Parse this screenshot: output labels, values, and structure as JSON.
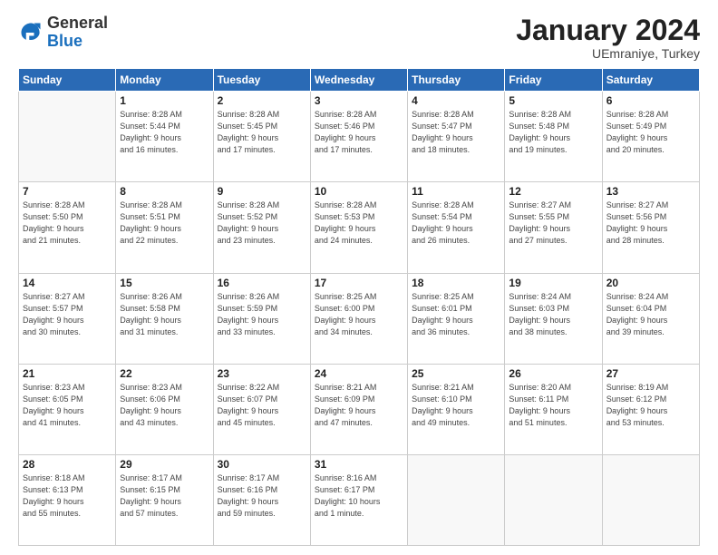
{
  "header": {
    "logo_general": "General",
    "logo_blue": "Blue",
    "title": "January 2024",
    "subtitle": "UEmraniye, Turkey"
  },
  "days_of_week": [
    "Sunday",
    "Monday",
    "Tuesday",
    "Wednesday",
    "Thursday",
    "Friday",
    "Saturday"
  ],
  "weeks": [
    [
      {
        "day": "",
        "info": ""
      },
      {
        "day": "1",
        "info": "Sunrise: 8:28 AM\nSunset: 5:44 PM\nDaylight: 9 hours\nand 16 minutes."
      },
      {
        "day": "2",
        "info": "Sunrise: 8:28 AM\nSunset: 5:45 PM\nDaylight: 9 hours\nand 17 minutes."
      },
      {
        "day": "3",
        "info": "Sunrise: 8:28 AM\nSunset: 5:46 PM\nDaylight: 9 hours\nand 17 minutes."
      },
      {
        "day": "4",
        "info": "Sunrise: 8:28 AM\nSunset: 5:47 PM\nDaylight: 9 hours\nand 18 minutes."
      },
      {
        "day": "5",
        "info": "Sunrise: 8:28 AM\nSunset: 5:48 PM\nDaylight: 9 hours\nand 19 minutes."
      },
      {
        "day": "6",
        "info": "Sunrise: 8:28 AM\nSunset: 5:49 PM\nDaylight: 9 hours\nand 20 minutes."
      }
    ],
    [
      {
        "day": "7",
        "info": "Sunrise: 8:28 AM\nSunset: 5:50 PM\nDaylight: 9 hours\nand 21 minutes."
      },
      {
        "day": "8",
        "info": "Sunrise: 8:28 AM\nSunset: 5:51 PM\nDaylight: 9 hours\nand 22 minutes."
      },
      {
        "day": "9",
        "info": "Sunrise: 8:28 AM\nSunset: 5:52 PM\nDaylight: 9 hours\nand 23 minutes."
      },
      {
        "day": "10",
        "info": "Sunrise: 8:28 AM\nSunset: 5:53 PM\nDaylight: 9 hours\nand 24 minutes."
      },
      {
        "day": "11",
        "info": "Sunrise: 8:28 AM\nSunset: 5:54 PM\nDaylight: 9 hours\nand 26 minutes."
      },
      {
        "day": "12",
        "info": "Sunrise: 8:27 AM\nSunset: 5:55 PM\nDaylight: 9 hours\nand 27 minutes."
      },
      {
        "day": "13",
        "info": "Sunrise: 8:27 AM\nSunset: 5:56 PM\nDaylight: 9 hours\nand 28 minutes."
      }
    ],
    [
      {
        "day": "14",
        "info": "Sunrise: 8:27 AM\nSunset: 5:57 PM\nDaylight: 9 hours\nand 30 minutes."
      },
      {
        "day": "15",
        "info": "Sunrise: 8:26 AM\nSunset: 5:58 PM\nDaylight: 9 hours\nand 31 minutes."
      },
      {
        "day": "16",
        "info": "Sunrise: 8:26 AM\nSunset: 5:59 PM\nDaylight: 9 hours\nand 33 minutes."
      },
      {
        "day": "17",
        "info": "Sunrise: 8:25 AM\nSunset: 6:00 PM\nDaylight: 9 hours\nand 34 minutes."
      },
      {
        "day": "18",
        "info": "Sunrise: 8:25 AM\nSunset: 6:01 PM\nDaylight: 9 hours\nand 36 minutes."
      },
      {
        "day": "19",
        "info": "Sunrise: 8:24 AM\nSunset: 6:03 PM\nDaylight: 9 hours\nand 38 minutes."
      },
      {
        "day": "20",
        "info": "Sunrise: 8:24 AM\nSunset: 6:04 PM\nDaylight: 9 hours\nand 39 minutes."
      }
    ],
    [
      {
        "day": "21",
        "info": "Sunrise: 8:23 AM\nSunset: 6:05 PM\nDaylight: 9 hours\nand 41 minutes."
      },
      {
        "day": "22",
        "info": "Sunrise: 8:23 AM\nSunset: 6:06 PM\nDaylight: 9 hours\nand 43 minutes."
      },
      {
        "day": "23",
        "info": "Sunrise: 8:22 AM\nSunset: 6:07 PM\nDaylight: 9 hours\nand 45 minutes."
      },
      {
        "day": "24",
        "info": "Sunrise: 8:21 AM\nSunset: 6:09 PM\nDaylight: 9 hours\nand 47 minutes."
      },
      {
        "day": "25",
        "info": "Sunrise: 8:21 AM\nSunset: 6:10 PM\nDaylight: 9 hours\nand 49 minutes."
      },
      {
        "day": "26",
        "info": "Sunrise: 8:20 AM\nSunset: 6:11 PM\nDaylight: 9 hours\nand 51 minutes."
      },
      {
        "day": "27",
        "info": "Sunrise: 8:19 AM\nSunset: 6:12 PM\nDaylight: 9 hours\nand 53 minutes."
      }
    ],
    [
      {
        "day": "28",
        "info": "Sunrise: 8:18 AM\nSunset: 6:13 PM\nDaylight: 9 hours\nand 55 minutes."
      },
      {
        "day": "29",
        "info": "Sunrise: 8:17 AM\nSunset: 6:15 PM\nDaylight: 9 hours\nand 57 minutes."
      },
      {
        "day": "30",
        "info": "Sunrise: 8:17 AM\nSunset: 6:16 PM\nDaylight: 9 hours\nand 59 minutes."
      },
      {
        "day": "31",
        "info": "Sunrise: 8:16 AM\nSunset: 6:17 PM\nDaylight: 10 hours\nand 1 minute."
      },
      {
        "day": "",
        "info": ""
      },
      {
        "day": "",
        "info": ""
      },
      {
        "day": "",
        "info": ""
      }
    ]
  ]
}
